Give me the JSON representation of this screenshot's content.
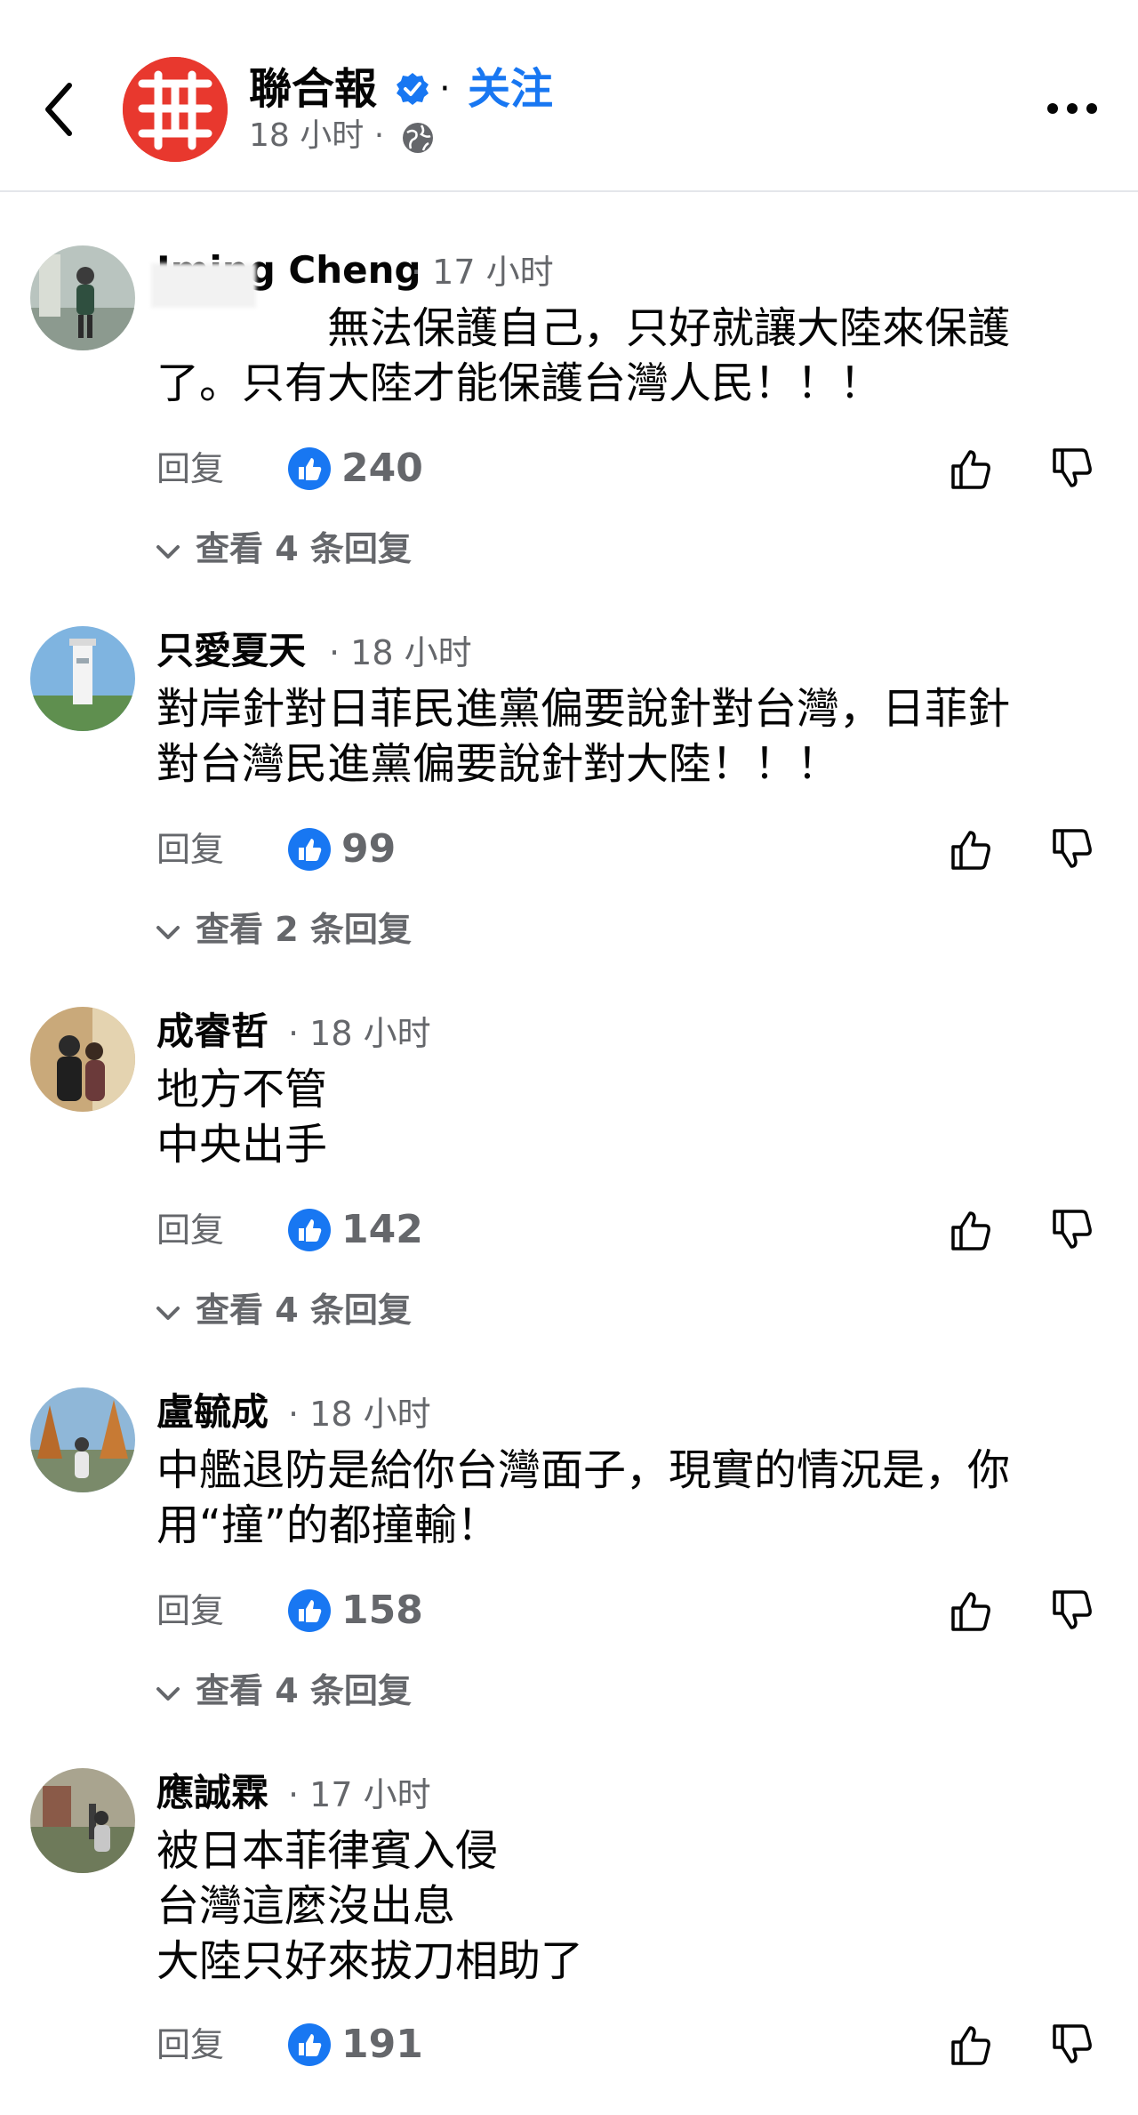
{
  "header": {
    "page_name": "聯合報",
    "separator": "·",
    "follow_label": "关注",
    "time": "18 小时 ·"
  },
  "comments": [
    {
      "author": "Iming Cheng",
      "time": "· 17 小时",
      "text": "　　　　無法保護自己，只好就讓大陸來保護\n了。只有大陸才能保護台灣人民！！！",
      "reply_label": "回复",
      "likes": "240",
      "view_replies": "查看 4 条回复"
    },
    {
      "author": "只愛夏天",
      "time": "· 18 小时",
      "text": "對岸針對日菲民進黨偏要說針對台灣，日菲針\n對台灣民進黨偏要說針對大陸！！！",
      "reply_label": "回复",
      "likes": "99",
      "view_replies": "查看 2 条回复"
    },
    {
      "author": "成睿哲",
      "time": "· 18 小时",
      "text": "地方不管\n中央出手",
      "reply_label": "回复",
      "likes": "142",
      "view_replies": "查看 4 条回复"
    },
    {
      "author": "盧毓成",
      "time": "· 18 小时",
      "text": "中艦退防是給你台灣面子，現實的情況是，你\n用“撞”的都撞輸！",
      "reply_label": "回复",
      "likes": "158",
      "view_replies": "查看 4 条回复"
    },
    {
      "author": "應誠霖",
      "time": "· 17 小时",
      "text": "被日本菲律賓入侵\n台灣這麼沒出息\n大陸只好來拔刀相助了",
      "reply_label": "回复",
      "likes": "191"
    }
  ],
  "icons": {
    "back": "chevron-left-icon",
    "verified": "verified-badge-icon",
    "globe": "globe-icon",
    "more": "more-horizontal-icon",
    "like": "like-reaction-icon",
    "thumb_up": "thumbs-up-icon",
    "thumb_down": "thumbs-down-icon"
  },
  "colors": {
    "accent": "#1877f2",
    "brand": "#e8382e",
    "secondary_text": "#65676b"
  }
}
